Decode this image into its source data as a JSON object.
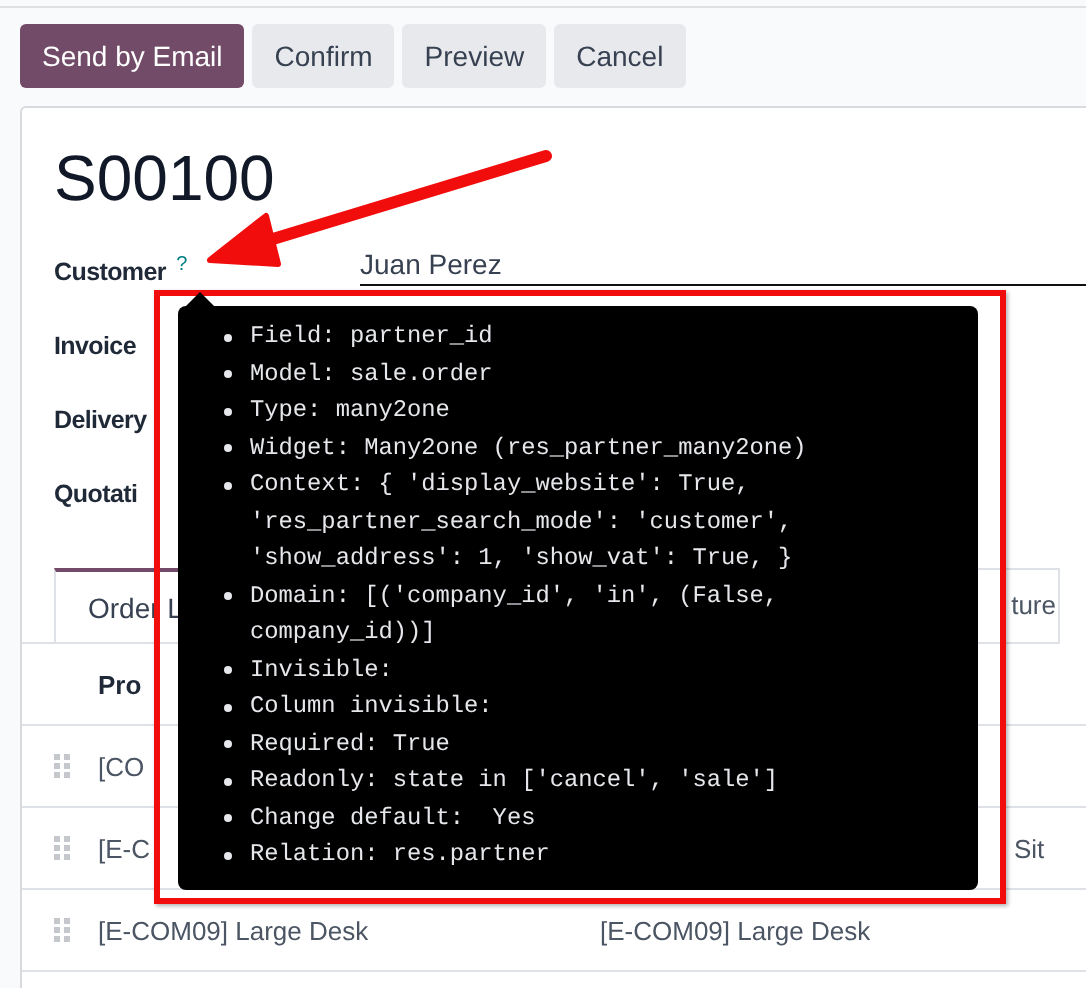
{
  "toolbar": {
    "buttons": [
      {
        "label": "Send by Email",
        "kind": "primary"
      },
      {
        "label": "Confirm",
        "kind": "secondary"
      },
      {
        "label": "Preview",
        "kind": "secondary"
      },
      {
        "label": "Cancel",
        "kind": "secondary"
      }
    ]
  },
  "form": {
    "title": "S00100",
    "fields": [
      {
        "label": "Customer",
        "help": "?",
        "value": "Juan Perez"
      },
      {
        "label": "Invoice"
      },
      {
        "label": "Delivery"
      },
      {
        "label": "Quotati"
      }
    ],
    "tabs": [
      {
        "label": "Order L",
        "selected": true
      },
      {
        "label": "ture",
        "selected": false
      }
    ],
    "table": {
      "columns": [
        "Pro"
      ],
      "rows": [
        {
          "column_1": "[CO"
        },
        {
          "column_1": "[E-C",
          "column_3": "Sit"
        },
        {
          "column_1": "[E-COM09] Large Desk",
          "column_2": "[E-COM09] Large Desk"
        }
      ]
    }
  },
  "tooltip": {
    "items": [
      "Field: partner_id",
      "Model: sale.order",
      "Type: many2one",
      "Widget: Many2one (res_partner_many2one)",
      "Context: { 'display_website': True, 'res_partner_search_mode': 'customer', 'show_address': 1, 'show_vat': True, }",
      "Domain: [('company_id', 'in', (False, company_id))]",
      "Invisible:",
      "Column invisible:",
      "Required: True",
      "Readonly: state in ['cancel', 'sale']",
      "Change default:  Yes",
      "Relation: res.partner"
    ]
  }
}
